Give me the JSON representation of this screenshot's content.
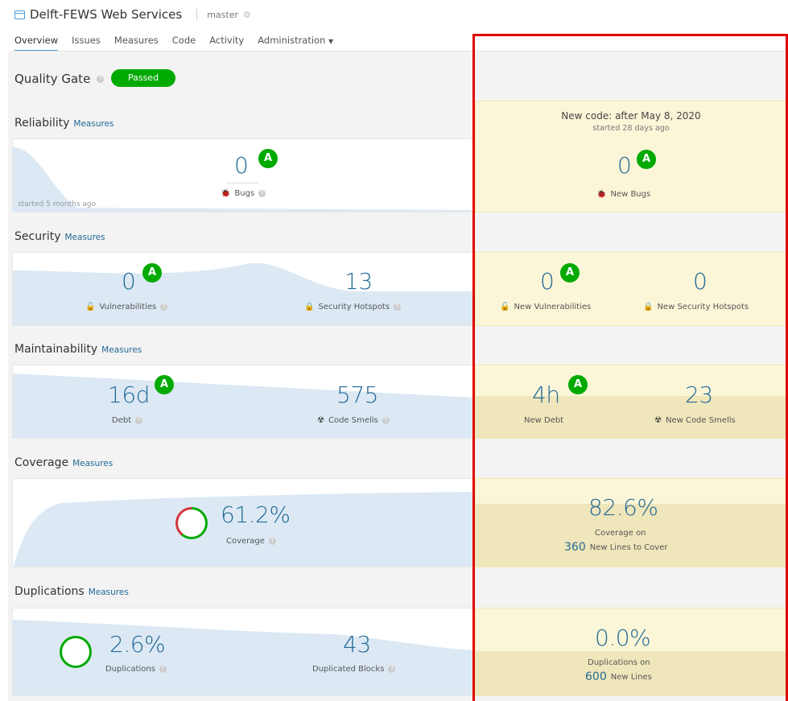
{
  "header": {
    "project_name": "Delft-FEWS Web Services",
    "branch": "master"
  },
  "tabs": [
    "Overview",
    "Issues",
    "Measures",
    "Code",
    "Activity",
    "Administration"
  ],
  "quality_gate": {
    "label": "Quality Gate",
    "status": "Passed"
  },
  "new_code": {
    "title": "New code: after May 8, 2020",
    "subtitle": "started 28 days ago"
  },
  "measures_link": "Measures",
  "reliability": {
    "title": "Reliability",
    "started": "started 5 months ago",
    "bugs_value": "0",
    "bugs_rating": "A",
    "bugs_label": "Bugs",
    "new_bugs_value": "0",
    "new_bugs_rating": "A",
    "new_bugs_label": "New Bugs"
  },
  "security": {
    "title": "Security",
    "vuln_value": "0",
    "vuln_rating": "A",
    "vuln_label": "Vulnerabilities",
    "hotspots_value": "13",
    "hotspots_label": "Security Hotspots",
    "new_vuln_value": "0",
    "new_vuln_rating": "A",
    "new_vuln_label": "New Vulnerabilities",
    "new_hotspots_value": "0",
    "new_hotspots_label": "New Security Hotspots"
  },
  "maintainability": {
    "title": "Maintainability",
    "debt_value": "16d",
    "debt_rating": "A",
    "debt_label": "Debt",
    "smells_value": "575",
    "smells_label": "Code Smells",
    "new_debt_value": "4h",
    "new_debt_rating": "A",
    "new_debt_label": "New Debt",
    "new_smells_value": "23",
    "new_smells_label": "New Code Smells"
  },
  "coverage": {
    "title": "Coverage",
    "value": "61.2%",
    "label": "Coverage",
    "new_value": "82.6%",
    "new_label": "Coverage on",
    "new_lines_count": "360",
    "new_lines_label": "New Lines to Cover"
  },
  "duplications": {
    "title": "Duplications",
    "value": "2.6%",
    "label": "Duplications",
    "blocks_value": "43",
    "blocks_label": "Duplicated Blocks",
    "new_value": "0.0%",
    "new_label": "Duplications on",
    "new_lines_count": "600",
    "new_lines_label": "New Lines"
  },
  "colors": {
    "accent": "#236a97",
    "rating_a": "#00aa00",
    "highlight_box": "#e00000",
    "new_code_bg": "#fcf6d8"
  }
}
